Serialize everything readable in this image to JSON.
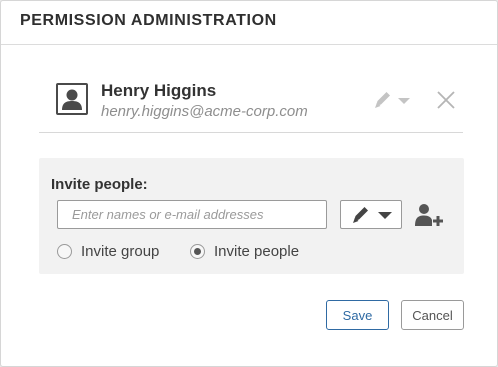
{
  "dialog": {
    "title": "PERMISSION ADMINISTRATION"
  },
  "user": {
    "name": "Henry Higgins",
    "email": "henry.higgins@acme-corp.com",
    "avatar_icon": "person-icon",
    "edit_icon": "pencil-icon",
    "dropdown_icon": "chevron-down-icon",
    "remove_icon": "close-icon"
  },
  "invite": {
    "label": "Invite people:",
    "placeholder": "Enter names or e-mail addresses",
    "value": "",
    "permission_icon": "pencil-icon",
    "add_icon": "add-person-icon",
    "options": [
      {
        "label": "Invite group",
        "checked": false
      },
      {
        "label": "Invite people",
        "checked": true
      }
    ]
  },
  "buttons": {
    "save": "Save",
    "cancel": "Cancel"
  },
  "colors": {
    "accent": "#2f6aa3",
    "panel_bg": "#f2f2f2",
    "muted_icon": "#c4c4c4"
  }
}
